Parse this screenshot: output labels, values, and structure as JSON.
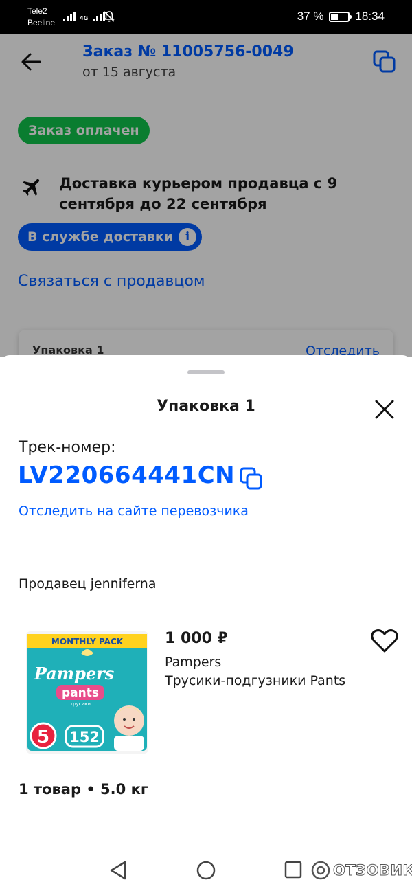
{
  "status_bar": {
    "carrier_1": "Tele2",
    "carrier_2": "Beeline",
    "network": "4G",
    "battery_text": "37 %",
    "battery_level": 0.37,
    "time": "18:34"
  },
  "order": {
    "title": "Заказ № 11005756-0049",
    "date": "от 15 августа",
    "status_badge": "Заказ оплачен",
    "delivery_text": "Доставка курьером продавца с 9 сентября до 22 сентября",
    "delivery_status": "В службе доставки",
    "contact_seller": "Связаться с продавцом",
    "package_label": "Упаковка 1",
    "track_link": "Отследить"
  },
  "sheet": {
    "title": "Упаковка 1",
    "track_label": "Трек-номер:",
    "track_number": "LV220664441CN",
    "carrier_link": "Отследить на сайте перевозчика",
    "seller": "Продавец jenniferna",
    "product": {
      "price": "1 000 ₽",
      "brand": "Pampers",
      "name": "Трусики-подгузники Pants",
      "image": {
        "banner": "MONTHLY PACK",
        "logo": "Pampers",
        "sub": "pants",
        "sub_small": "трусики",
        "size": "5",
        "count": "152"
      }
    },
    "summary": "1 товар • 5.0 кг"
  },
  "watermark": "ОТЗОВИК",
  "colors": {
    "accent": "#005bff",
    "paid_green": "#10c44c"
  }
}
